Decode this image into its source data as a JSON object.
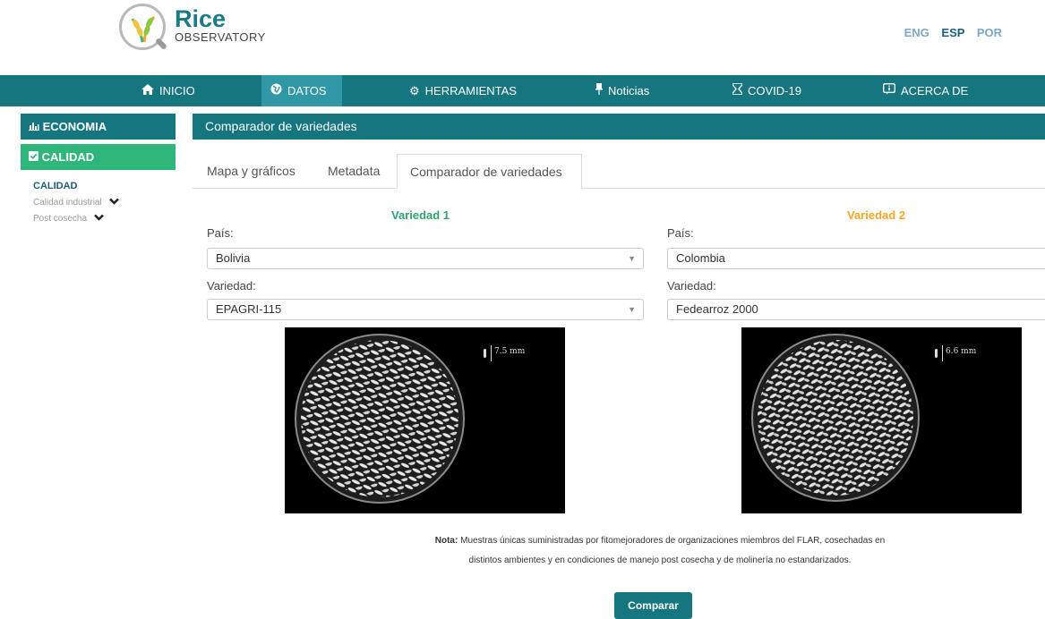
{
  "header": {
    "logo_title": "Rice",
    "logo_subtitle": "OBSERVATORY",
    "languages": [
      "ENG",
      "ESP",
      "POR"
    ],
    "active_language": "ESP"
  },
  "nav": {
    "items": [
      {
        "label": "INICIO",
        "icon": "home-icon"
      },
      {
        "label": "DATOS",
        "icon": "globe-icon"
      },
      {
        "label": "HERRAMIENTAS",
        "icon": "gear-icon"
      },
      {
        "label": "Noticias",
        "icon": "pin-icon"
      },
      {
        "label": "COVID-19",
        "icon": "hourglass-icon"
      },
      {
        "label": "ACERCA DE",
        "icon": "info-icon"
      }
    ],
    "active": "DATOS"
  },
  "sidebar": {
    "economia": "ECONOMIA",
    "calidad": "CALIDAD",
    "section": "CALIDAD",
    "links": [
      "Calidad industrial",
      "Post cosecha"
    ]
  },
  "main": {
    "title": "Comparador de variedades",
    "tabs": [
      "Mapa y gráficos",
      "Metadata",
      "Comparador de variedades"
    ],
    "active_tab": "Comparador de variedades"
  },
  "variety1": {
    "title": "Variedad 1",
    "country_label": "País:",
    "country": "Bolivia",
    "variety_label": "Variedad:",
    "variety": "EPAGRI-115",
    "scale": "7.5 mm"
  },
  "variety2": {
    "title": "Variedad 2",
    "country_label": "País:",
    "country": "Colombia",
    "variety_label": "Variedad:",
    "variety": "Fedearroz 2000",
    "scale": "6.6 mm"
  },
  "note": {
    "label": "Nota:",
    "text": "Muestras únicas suministradas por fitomejoradores de organizaciones miembros del FLAR, cosechadas en distintos ambientes y en condiciones de manejo post cosecha y de molinería no estandarizados."
  },
  "compare_button": "Comparar",
  "colors": {
    "brand_teal": "#167680",
    "nav_active": "#2f97a6",
    "calidad_green": "#2fb77b",
    "variety1_color": "#2fa36b",
    "variety2_color": "#f5a623"
  }
}
